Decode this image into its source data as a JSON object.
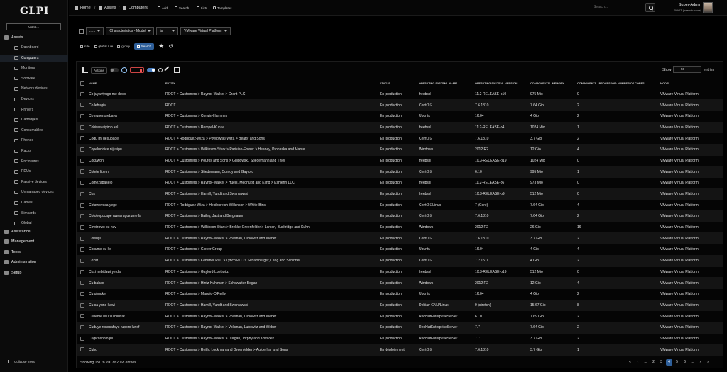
{
  "app": {
    "logo": "GLPI"
  },
  "sidebar": {
    "goto_label": "Go to...",
    "assets_label": "Assets",
    "items": [
      {
        "label": "Dashboard",
        "icon": "dashboard-icon"
      },
      {
        "label": "Computers",
        "icon": "computer-icon",
        "active": true
      },
      {
        "label": "Monitors",
        "icon": "monitor-icon"
      },
      {
        "label": "Software",
        "icon": "software-icon"
      },
      {
        "label": "Network devices",
        "icon": "network-icon"
      },
      {
        "label": "Devices",
        "icon": "devices-icon"
      },
      {
        "label": "Printers",
        "icon": "printer-icon"
      },
      {
        "label": "Cartridges",
        "icon": "cartridge-icon"
      },
      {
        "label": "Consumables",
        "icon": "consumable-icon"
      },
      {
        "label": "Phones",
        "icon": "phone-icon"
      },
      {
        "label": "Racks",
        "icon": "rack-icon"
      },
      {
        "label": "Enclosures",
        "icon": "enclosure-icon"
      },
      {
        "label": "PDUs",
        "icon": "pdu-icon"
      },
      {
        "label": "Passive devices",
        "icon": "passive-device-icon"
      },
      {
        "label": "Unmanaged devices",
        "icon": "unmanaged-device-icon"
      },
      {
        "label": "Cables",
        "icon": "cable-icon"
      },
      {
        "label": "Simcards",
        "icon": "simcard-icon"
      },
      {
        "label": "Global",
        "icon": "global-icon"
      }
    ],
    "sections": [
      "Assistance",
      "Management",
      "Tools",
      "Administration",
      "Setup"
    ],
    "collapse_label": "Collapse menu"
  },
  "header": {
    "breadcrumb": [
      "Home",
      "Assets",
      "Computers"
    ],
    "buttons": [
      "Add",
      "Search",
      "Lists",
      "Templates"
    ],
    "search_placeholder": "Search...",
    "user_name": "Super-Admin",
    "user_entity": "ROOT (tree structure)"
  },
  "criteria": {
    "link": "......",
    "field": "Characteristics - Model",
    "operator": "is",
    "value": "VMware Virtual Platform",
    "actions": [
      "rule",
      "global rule",
      "group"
    ],
    "search_label": "Search"
  },
  "results": {
    "actions_label": "Actions",
    "show_label": "Show",
    "show_value": "50",
    "entries_label": "entries",
    "columns": [
      "NAME",
      "ENTITY",
      "STATUS",
      "OPERATING SYSTEM - NAME",
      "OPERATING SYSTEM - VERSION",
      "COMPONENTS - MEMORY",
      "COMPONENTS - PROCESSOR: NUMBER OF CORES",
      "MODEL"
    ],
    "rows": [
      [
        "Co juyaviyugo me duvo",
        "ROOT > Customers > Raynor-Walker > Grant PLC",
        "En production",
        "freebsd",
        "11.2-RELEASE-p10",
        "975 Mio",
        "0",
        "VMware Virtual Platform"
      ],
      [
        "Co lehugiw",
        "ROOT",
        "En production",
        "CentOS",
        "7.6.1810",
        "7.64 Gio",
        "2",
        "VMware Virtual Platform"
      ],
      [
        "Co nunenorebava",
        "ROOT > Customers > Corwin-Hammes",
        "En production",
        "Ubuntu",
        "16.04",
        "4 Gio",
        "2",
        "VMware Virtual Platform"
      ],
      [
        "Cobiwavaiyimo xol",
        "ROOT > Customers > Rempel-Kunze",
        "En production",
        "freebsd",
        "11.2-RELEASE-p4",
        "1024 Mio",
        "1",
        "VMware Virtual Platform"
      ],
      [
        "Codu mi desupage",
        "ROOT > Rodriguez-Wiza > Powlowski-Wiza > Beatty and Sons",
        "En production",
        "CentOS",
        "7.6.1810",
        "3.7 Gio",
        "2",
        "VMware Virtual Platform"
      ],
      [
        "Copelucicice nijusipu",
        "ROOT > Customers > Wilkinson-Stark > Parisian-Ernser > Heaney, Prohaska and Mante",
        "En production",
        "Windows",
        "2012 R2",
        "12 Gio",
        "4",
        "VMware Virtual Platform"
      ],
      [
        "Cokuwon",
        "ROOT > Customers > Pouros and Sons > Gulgowski, Stiedemann and Thiel",
        "En production",
        "freebsd",
        "10.3-RELEASE-p19",
        "1024 Mio",
        "0",
        "VMware Virtual Platform"
      ],
      [
        "Colete lipe n",
        "ROOT > Customers > Stiedemann, Conroy and Gaylord",
        "En production",
        "CentOS",
        "6.10",
        "995 Mio",
        "1",
        "VMware Virtual Platform"
      ],
      [
        "Comezabaselo",
        "ROOT > Customers > Raynor-Walker > Huels, Medhurst and Kling > Kshlerin LLC",
        "En production",
        "freebsd",
        "11.2-RELEASE-p6",
        "973 Mio",
        "0",
        "VMware Virtual Platform"
      ],
      [
        "Cos",
        "ROOT > Customers > Hamill, Yundt and Swaniawski",
        "En production",
        "freebsd",
        "10.3-RELEASE-p9",
        "512 Mio",
        "0",
        "VMware Virtual Platform"
      ],
      [
        "Cotawovaca yege",
        "ROOT > Rodriguez-Wiza > Heidenreich-Wilkinson > White-Bins",
        "En production",
        "CentOS Linux",
        "7 (Core)",
        "7.64 Gio",
        "4",
        "VMware Virtual Platform"
      ],
      [
        "Cotohopocape ruwa raguzume fa",
        "ROOT > Customers > Bailey, Jast and Bergnaum",
        "En production",
        "CentOS",
        "7.6.1810",
        "7.64 Gio",
        "2",
        "VMware Virtual Platform"
      ],
      [
        "Cowizowo cu huv",
        "ROOT > Customers > Wilkinson-Stark > Brekke-Greenfelder > Larson, Buckridge and Kuhn",
        "En production",
        "Windows",
        "2012 R2",
        "26 Gio",
        "16",
        "VMware Virtual Platform"
      ],
      [
        "Cowugi",
        "ROOT > Customers > Raynor-Walker > Volkman, Lubowitz and Weber",
        "En production",
        "CentOS",
        "7.6.1810",
        "3.7 Gio",
        "2",
        "VMware Virtual Platform"
      ],
      [
        "Coxume cu ko",
        "ROOT > Customers > Glover Group",
        "En production",
        "Ubuntu",
        "16.04",
        "4 Gio",
        "4",
        "VMware Virtual Platform"
      ],
      [
        "Cozat",
        "ROOT > Customers > Kemmer PLC > Lynch PLC > Schamberger, Lang and Schinner",
        "En production",
        "CentOS",
        "7.2.1511",
        "4 Gio",
        "2",
        "VMware Virtual Platform"
      ],
      [
        "Cozi nebidawi ye da",
        "ROOT > Customers > Gaylord-Luettwitz",
        "En production",
        "freebsd",
        "10.3-RELEASE-p19",
        "512 Mio",
        "0",
        "VMware Virtual Platform"
      ],
      [
        "Cu babax",
        "ROOT > Customers > Hintz-Kuhlman > Schowalter-Bogan",
        "En production",
        "Windows",
        "2012 R2",
        "12 Gio",
        "4",
        "VMware Virtual Platform"
      ],
      [
        "Cu gimuke",
        "ROOT > Customers > Maggio-O'Reilly",
        "En production",
        "Ubuntu",
        "16.04",
        "4 Gio",
        "2",
        "VMware Virtual Platform"
      ],
      [
        "Cu sa yuno kawi",
        "ROOT > Customers > Hamill, Yundt and Swaniawski",
        "En production",
        "Debian GNU/Linux",
        "9 (stretch)",
        "15.67 Gio",
        "8",
        "VMware Virtual Platform"
      ],
      [
        "Cubeme leju zu biluxaf",
        "ROOT > Customers > Raynor-Walker > Volkman, Lubowitz and Weber",
        "En production",
        "RedHatEnterpriseServer",
        "6.10",
        "7.69 Gio",
        "2",
        "VMware Virtual Platform"
      ],
      [
        "Cuduye ronocafoyu ruporo lunof",
        "ROOT > Customers > Raynor-Walker > Volkman, Lubowitz and Weber",
        "En production",
        "RedHatEnterpriseServer",
        "7.7",
        "7.64 Gio",
        "2",
        "VMware Virtual Platform"
      ],
      [
        "Cugicosohio jul",
        "ROOT > Customers > Raynor-Walker > Durgan, Torphy and Kovacek",
        "En production",
        "RedHatEnterpriseServer",
        "7.7",
        "3.7 Gio",
        "2",
        "VMware Virtual Platform"
      ],
      [
        "Cuho",
        "ROOT > Customers > Reilly, Lockman and Greenfelder > Aufderhar and Sons",
        "En déploiement",
        "CentOS",
        "7.6.1810",
        "3.7 Gio",
        "1",
        "VMware Virtual Platform"
      ]
    ],
    "showing_text": "Showing 151 to 200 of 2068 entries",
    "pages": [
      "«",
      "‹",
      "...",
      "2",
      "3",
      "4",
      "5",
      "6",
      "...",
      "›",
      "»"
    ],
    "current_page": "4"
  },
  "colors": {
    "accent": "#2e5f9a",
    "background": "#000000",
    "row_alt": "#141414"
  }
}
